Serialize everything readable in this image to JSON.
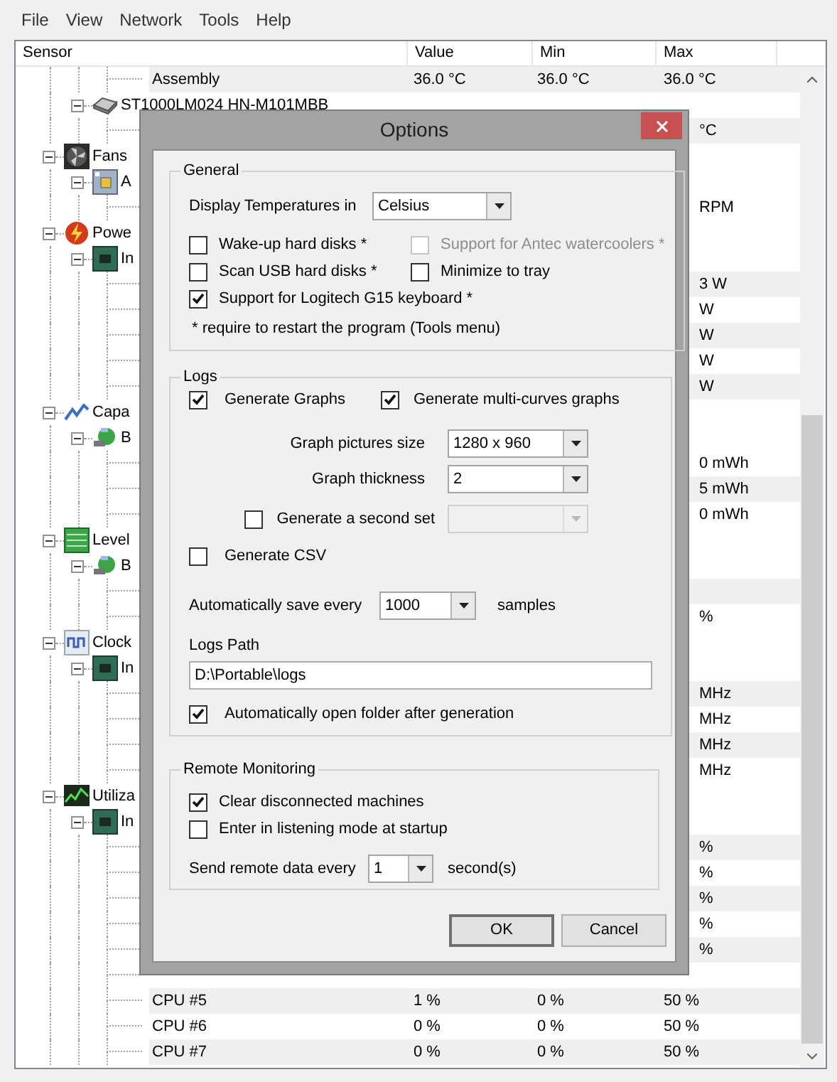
{
  "menu": [
    "File",
    "View",
    "Network",
    "Tools",
    "Help"
  ],
  "columns": [
    "Sensor",
    "Value",
    "Min",
    "Max"
  ],
  "tree": [
    {
      "kind": "offscreen",
      "children": [
        {
          "kind": "offscreen",
          "children": [
            {
              "kind": "sensor",
              "label": "Assembly",
              "value": "36.0 °C",
              "min": "36.0 °C",
              "max": "36.0 °C"
            }
          ]
        },
        {
          "kind": "disk",
          "label": "ST1000LM024 HN-M101MBB",
          "expanded": true,
          "children": [
            {
              "kind": "sensor",
              "max": "°C",
              "clipped": true
            }
          ]
        }
      ]
    },
    {
      "kind": "fans",
      "label": "Fans",
      "expanded": true,
      "children": [
        {
          "kind": "board",
          "label": "A",
          "expanded": true,
          "children": [
            {
              "kind": "sensor",
              "max": "RPM",
              "clipped": true
            }
          ]
        }
      ]
    },
    {
      "kind": "power",
      "label": "Powe",
      "expanded": true,
      "children": [
        {
          "kind": "cpu",
          "label": "In",
          "expanded": true,
          "children": [
            {
              "kind": "sensor",
              "max": "3 W",
              "clipped": true
            },
            {
              "kind": "sensor",
              "max": "W",
              "clipped": true
            },
            {
              "kind": "sensor",
              "max": "W",
              "clipped": true
            },
            {
              "kind": "sensor",
              "max": "W",
              "clipped": true
            },
            {
              "kind": "sensor",
              "max": "W",
              "clipped": true
            }
          ]
        }
      ]
    },
    {
      "kind": "capacity",
      "label": "Capa",
      "expanded": true,
      "children": [
        {
          "kind": "battery",
          "label": "B",
          "expanded": true,
          "children": [
            {
              "kind": "sensor",
              "max": "0 mWh",
              "clipped": true
            },
            {
              "kind": "sensor",
              "max": "5 mWh",
              "clipped": true
            },
            {
              "kind": "sensor",
              "max": "0 mWh",
              "clipped": true
            }
          ]
        }
      ]
    },
    {
      "kind": "levels",
      "label": "Level",
      "expanded": true,
      "children": [
        {
          "kind": "battery",
          "label": "B",
          "expanded": true,
          "children": [
            {
              "kind": "sensor"
            },
            {
              "kind": "sensor",
              "max": "%",
              "clipped": true
            }
          ]
        }
      ]
    },
    {
      "kind": "clocks",
      "label": "Clock",
      "expanded": true,
      "children": [
        {
          "kind": "cpu",
          "label": "In",
          "expanded": true,
          "children": [
            {
              "kind": "sensor",
              "max": "MHz",
              "clipped": true
            },
            {
              "kind": "sensor",
              "max": "MHz",
              "clipped": true
            },
            {
              "kind": "sensor",
              "max": "MHz",
              "clipped": true
            },
            {
              "kind": "sensor",
              "max": "MHz",
              "clipped": true
            }
          ]
        }
      ]
    },
    {
      "kind": "load",
      "label": "Utiliza",
      "expanded": true,
      "children": [
        {
          "kind": "cpu",
          "label": "In",
          "expanded": true,
          "children": [
            {
              "kind": "sensor",
              "max": "%",
              "clipped": true
            },
            {
              "kind": "sensor",
              "max": "%",
              "clipped": true
            },
            {
              "kind": "sensor",
              "max": "%",
              "clipped": true
            },
            {
              "kind": "sensor",
              "max": "%",
              "clipped": true
            },
            {
              "kind": "sensor",
              "max": "%",
              "clipped": true
            },
            {
              "kind": "sensor"
            },
            {
              "kind": "sensor",
              "label": "CPU #5",
              "value": "1 %",
              "min": "0 %",
              "max": "50 %"
            },
            {
              "kind": "sensor",
              "label": "CPU #6",
              "value": "0 %",
              "min": "0 %",
              "max": "50 %"
            },
            {
              "kind": "sensor",
              "label": "CPU #7",
              "value": "0 %",
              "min": "0 %",
              "max": "50 %"
            }
          ]
        }
      ]
    }
  ],
  "dialog": {
    "title": "Options",
    "general": {
      "legend": "General",
      "temperature": {
        "label": "Display Temperatures in",
        "value": "Celsius"
      },
      "options": [
        {
          "label": "Wake-up hard disks *",
          "checked": false,
          "disabled": false
        },
        {
          "label": "Support for Antec watercoolers *",
          "checked": false,
          "disabled": true
        },
        {
          "label": "Scan USB hard disks *",
          "checked": false,
          "disabled": false
        },
        {
          "label": "Minimize to tray",
          "checked": false,
          "disabled": false
        },
        {
          "label": "Support for Logitech G15 keyboard *",
          "checked": true,
          "disabled": false
        }
      ],
      "note": "* require to restart the program (Tools menu)"
    },
    "logs": {
      "legend": "Logs",
      "graphs": [
        {
          "label": "Generate Graphs",
          "checked": true
        },
        {
          "label": "Generate multi-curves graphs",
          "checked": true
        }
      ],
      "picture_size": {
        "label": "Graph pictures size",
        "value": "1280 x 960"
      },
      "thickness": {
        "label": "Graph thickness",
        "value": "2"
      },
      "second_set": {
        "label": "Generate a second set",
        "checked": false,
        "select_disabled": true
      },
      "csv": {
        "label": "Generate CSV",
        "checked": false
      },
      "autosave": {
        "label": "Automatically save every",
        "value": "1000",
        "unit": "samples"
      },
      "path": {
        "label": "Logs Path",
        "value": "D:\\Portable\\logs"
      },
      "auto_open": {
        "label": "Automatically open folder after generation",
        "checked": true
      }
    },
    "remote": {
      "legend": "Remote Monitoring",
      "options": [
        {
          "label": "Clear disconnected machines",
          "checked": true
        },
        {
          "label": "Enter in listening mode at startup",
          "checked": false
        }
      ],
      "send": {
        "label": "Send remote data every",
        "value": "1",
        "unit": "second(s)"
      }
    },
    "buttons": [
      {
        "label": "OK",
        "default": true
      },
      {
        "label": "Cancel",
        "default": false
      }
    ]
  }
}
